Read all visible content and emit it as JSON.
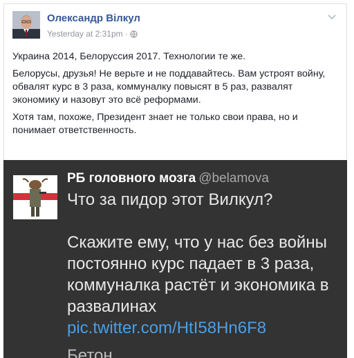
{
  "facebook_post": {
    "author_name": "Олександр Вілкул",
    "timestamp": "Yesterday at 2:31pm",
    "separator": "·",
    "privacy_icon": "globe-icon",
    "menu_icon": "chevron-down-icon",
    "paragraphs": [
      "Украина 2014, Белоруссия 2017. Технологии те же.",
      "Белорусы, друзья! Не верьте и не поддавайтесь. Вам устроят войну, обвалят курс в 3 раза, коммуналку повысят в 5 раз, развалят экономику и назовут это всё реформами.",
      "Хотя там, похоже, Президент знает не только свои права, но и понимает ответственность."
    ]
  },
  "tweet": {
    "display_name": "РБ головного мозга",
    "handle": "@belamova",
    "paragraphs": [
      "Что за пидор этот Вилкул?",
      "Скажите ему, что у нас без войны постоянно курс падает в 3 раза, коммуналка растёт и экономика в развалинах"
    ],
    "link": "pic.twitter.com/HtI58Hn6F8",
    "cut_off_text": "Бетон..."
  },
  "colors": {
    "fb_name": "#365899",
    "fb_meta": "#90949c",
    "tweet_bg": "#333333",
    "tweet_link": "#4a9fe6"
  }
}
